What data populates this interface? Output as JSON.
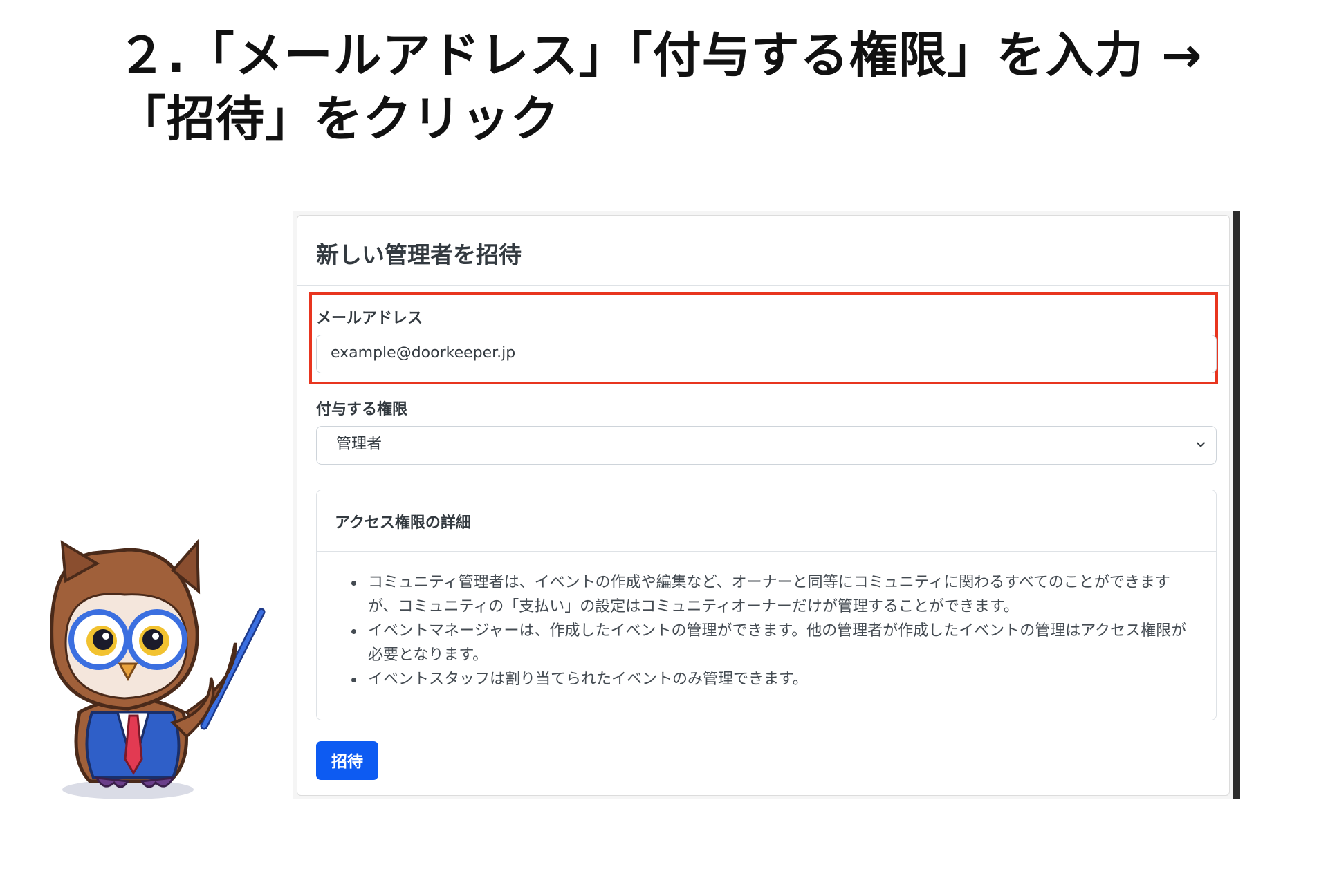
{
  "headline": {
    "line1": "２.「メールアドレス」「付与する権限」を入力 →",
    "line2": "「招待」をクリック"
  },
  "form": {
    "title": "新しい管理者を招待",
    "email": {
      "label": "メールアドレス",
      "value": "example@doorkeeper.jp"
    },
    "role": {
      "label": "付与する権限",
      "selected": "管理者"
    },
    "details": {
      "title": "アクセス権限の詳細",
      "items": [
        "コミュニティ管理者は、イベントの作成や編集など、オーナーと同等にコミュニティに関わるすべてのことができますが、コミュニティの「支払い」の設定はコミュニティオーナーだけが管理することができます。",
        "イベントマネージャーは、作成したイベントの管理ができます。他の管理者が作成したイベントの管理はアクセス権限が必要となります。",
        "イベントスタッフは割り当てられたイベントのみ管理できます。"
      ]
    },
    "submit_label": "招待"
  },
  "colors": {
    "highlight": "#e8351f",
    "primary_button": "#0d5bf2"
  },
  "icons": {
    "select": "chevron-down-icon",
    "mascot": "owl-teacher-illustration"
  }
}
